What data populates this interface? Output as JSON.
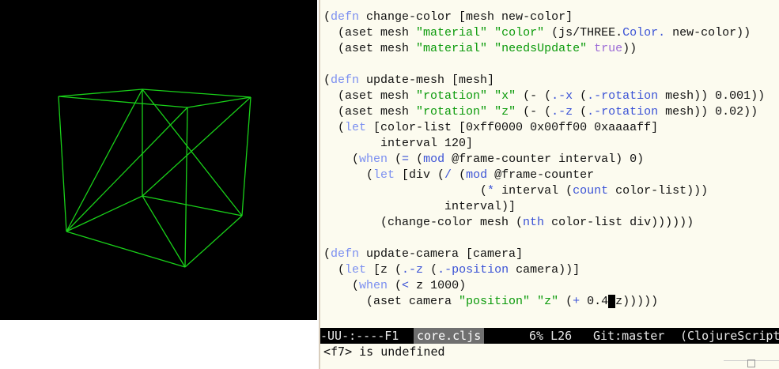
{
  "code_lines": [
    [
      {
        "t": "(",
        "c": ""
      },
      {
        "t": "defn",
        "c": "kw"
      },
      {
        "t": " change-color [mesh new-color]",
        "c": ""
      }
    ],
    [
      {
        "t": "  (aset mesh ",
        "c": ""
      },
      {
        "t": "\"material\"",
        "c": "str"
      },
      {
        "t": " ",
        "c": ""
      },
      {
        "t": "\"color\"",
        "c": "str"
      },
      {
        "t": " (js/THREE.",
        "c": ""
      },
      {
        "t": "Color.",
        "c": "fn"
      },
      {
        "t": " new-color))",
        "c": ""
      }
    ],
    [
      {
        "t": "  (aset mesh ",
        "c": ""
      },
      {
        "t": "\"material\"",
        "c": "str"
      },
      {
        "t": " ",
        "c": ""
      },
      {
        "t": "\"needsUpdate\"",
        "c": "str"
      },
      {
        "t": " ",
        "c": ""
      },
      {
        "t": "true",
        "c": "bool"
      },
      {
        "t": "))",
        "c": ""
      }
    ],
    [
      {
        "t": "",
        "c": ""
      }
    ],
    [
      {
        "t": "(",
        "c": ""
      },
      {
        "t": "defn",
        "c": "kw"
      },
      {
        "t": " update-mesh [mesh]",
        "c": ""
      }
    ],
    [
      {
        "t": "  (aset mesh ",
        "c": ""
      },
      {
        "t": "\"rotation\"",
        "c": "str"
      },
      {
        "t": " ",
        "c": ""
      },
      {
        "t": "\"x\"",
        "c": "str"
      },
      {
        "t": " (- (",
        "c": ""
      },
      {
        "t": ".-x",
        "c": "fn"
      },
      {
        "t": " (",
        "c": ""
      },
      {
        "t": ".-rotation",
        "c": "fn"
      },
      {
        "t": " mesh)) 0.001))",
        "c": ""
      }
    ],
    [
      {
        "t": "  (aset mesh ",
        "c": ""
      },
      {
        "t": "\"rotation\"",
        "c": "str"
      },
      {
        "t": " ",
        "c": ""
      },
      {
        "t": "\"z\"",
        "c": "str"
      },
      {
        "t": " (- (",
        "c": ""
      },
      {
        "t": ".-z",
        "c": "fn"
      },
      {
        "t": " (",
        "c": ""
      },
      {
        "t": ".-rotation",
        "c": "fn"
      },
      {
        "t": " mesh)) 0.02))",
        "c": ""
      }
    ],
    [
      {
        "t": "  (",
        "c": ""
      },
      {
        "t": "let",
        "c": "kw"
      },
      {
        "t": " [color-list [0xff0000 0x00ff00 0xaaaaff]",
        "c": ""
      }
    ],
    [
      {
        "t": "        interval 120]",
        "c": ""
      }
    ],
    [
      {
        "t": "    (",
        "c": ""
      },
      {
        "t": "when",
        "c": "kw"
      },
      {
        "t": " (",
        "c": ""
      },
      {
        "t": "=",
        "c": "fn"
      },
      {
        "t": " (",
        "c": ""
      },
      {
        "t": "mod",
        "c": "fn"
      },
      {
        "t": " @frame-counter interval) 0)",
        "c": ""
      }
    ],
    [
      {
        "t": "      (",
        "c": ""
      },
      {
        "t": "let",
        "c": "kw"
      },
      {
        "t": " [div (",
        "c": ""
      },
      {
        "t": "/",
        "c": "fn"
      },
      {
        "t": " (",
        "c": ""
      },
      {
        "t": "mod",
        "c": "fn"
      },
      {
        "t": " @frame-counter",
        "c": ""
      }
    ],
    [
      {
        "t": "                      (",
        "c": ""
      },
      {
        "t": "*",
        "c": "fn"
      },
      {
        "t": " interval (",
        "c": ""
      },
      {
        "t": "count",
        "c": "fn"
      },
      {
        "t": " color-list)))",
        "c": ""
      }
    ],
    [
      {
        "t": "                 interval)]",
        "c": ""
      }
    ],
    [
      {
        "t": "        (change-color mesh (",
        "c": ""
      },
      {
        "t": "nth",
        "c": "fn"
      },
      {
        "t": " color-list div))))))",
        "c": ""
      }
    ],
    [
      {
        "t": "",
        "c": ""
      }
    ],
    [
      {
        "t": "(",
        "c": ""
      },
      {
        "t": "defn",
        "c": "kw"
      },
      {
        "t": " update-camera [camera]",
        "c": ""
      }
    ],
    [
      {
        "t": "  (",
        "c": ""
      },
      {
        "t": "let",
        "c": "kw"
      },
      {
        "t": " [z (",
        "c": ""
      },
      {
        "t": ".-z",
        "c": "fn"
      },
      {
        "t": " (",
        "c": ""
      },
      {
        "t": ".-position",
        "c": "fn"
      },
      {
        "t": " camera))]",
        "c": ""
      }
    ],
    [
      {
        "t": "    (",
        "c": ""
      },
      {
        "t": "when",
        "c": "kw"
      },
      {
        "t": " (",
        "c": ""
      },
      {
        "t": "<",
        "c": "fn"
      },
      {
        "t": " z 1000)",
        "c": ""
      }
    ],
    [
      {
        "t": "      (aset camera ",
        "c": ""
      },
      {
        "t": "\"position\"",
        "c": "str"
      },
      {
        "t": " ",
        "c": ""
      },
      {
        "t": "\"z\"",
        "c": "str"
      },
      {
        "t": " (",
        "c": ""
      },
      {
        "t": "+",
        "c": "fn"
      },
      {
        "t": " 0.4",
        "c": ""
      },
      {
        "t": " ",
        "c": "cursor"
      },
      {
        "t": "z)))))",
        "c": ""
      }
    ]
  ],
  "modeline": {
    "status": "-UU-:----F1",
    "buffer": "core.cljs",
    "position": "6% L26",
    "vc": "Git:master",
    "mode": "(ClojureScript"
  },
  "minibuffer": "<f7> is undefined",
  "colors": {
    "wireframe": "#19d019",
    "canvas_bg": "#000000",
    "editor_bg": "#fcfbef"
  },
  "icons": {
    "scroll_corner": "scroll-icon"
  }
}
